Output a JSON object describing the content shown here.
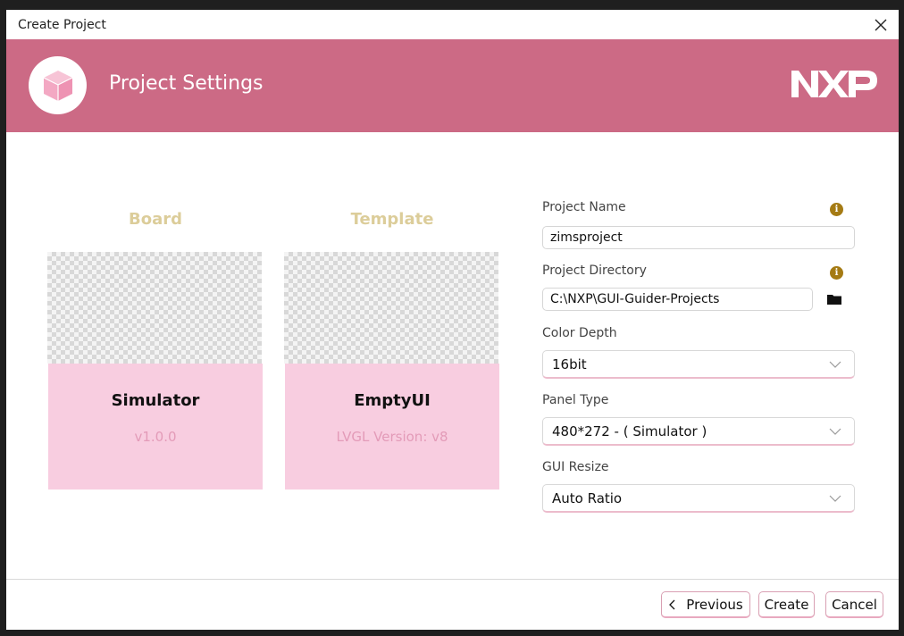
{
  "window": {
    "title": "Create Project",
    "close_glyph": "✕"
  },
  "banner": {
    "title": "Project Settings",
    "logo_icon": "cube-icon",
    "brand_icon": "nxp-logo",
    "color": "#cc6a85"
  },
  "board": {
    "heading": "Board",
    "name": "Simulator",
    "version": "v1.0.0"
  },
  "template": {
    "heading": "Template",
    "name": "EmptyUI",
    "version": "LVGL Version: v8"
  },
  "form": {
    "project_name_label": "Project Name",
    "project_name_value": "zimsproject",
    "project_dir_label": "Project Directory",
    "project_dir_value": "C:\\NXP\\GUI-Guider-Projects",
    "color_depth_label": "Color Depth",
    "color_depth_value": "16bit",
    "panel_type_label": "Panel Type",
    "panel_type_value": "480*272 - ( Simulator )",
    "gui_resize_label": "GUI Resize",
    "gui_resize_value": "Auto Ratio",
    "info_glyph": "i"
  },
  "footer": {
    "previous_label": "Previous",
    "previous_glyph": "‹",
    "create_label": "Create",
    "cancel_label": "Cancel"
  },
  "colors": {
    "card_bg": "#f8cde0",
    "heading": "#dccd9a",
    "sub_text": "#e39bb8",
    "info_icon": "#a57b14"
  }
}
